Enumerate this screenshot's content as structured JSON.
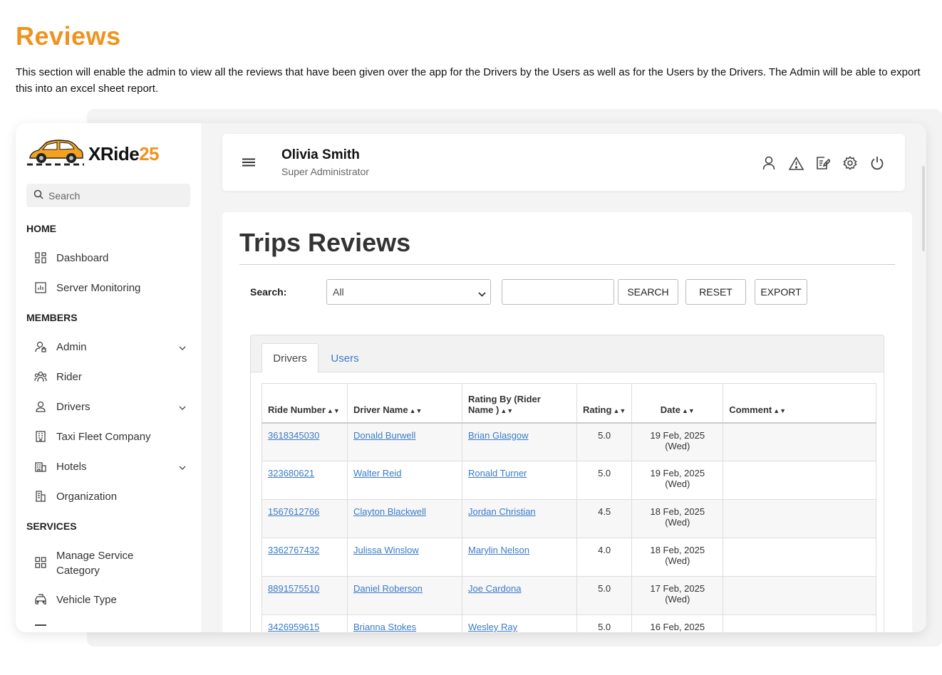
{
  "page": {
    "heading": "Reviews",
    "description": "This section will enable the admin to view all the reviews that have been given over the app for the Drivers by the Users as well as for the Users by the Drivers. The Admin will be able to export this into an excel sheet report."
  },
  "brand": {
    "name": "XRide",
    "suffix": "25",
    "accent": "#f0921e"
  },
  "sidebar": {
    "search_placeholder": "Search",
    "sections": {
      "home": "HOME",
      "members": "MEMBERS",
      "services": "SERVICES"
    },
    "items": {
      "dashboard": "Dashboard",
      "server_monitoring": "Server Monitoring",
      "admin": "Admin",
      "rider": "Rider",
      "drivers": "Drivers",
      "taxi_fleet": "Taxi Fleet Company",
      "hotels": "Hotels",
      "organization": "Organization",
      "manage_service_1": "Manage Service",
      "manage_service_2": "Category",
      "vehicle_type": "Vehicle Type"
    }
  },
  "header": {
    "user_name": "Olivia Smith",
    "user_role": "Super Administrator"
  },
  "main": {
    "title": "Trips Reviews",
    "search_label": "Search:",
    "filter_selected": "All",
    "search_button": "SEARCH",
    "reset_button": "RESET",
    "export_button": "EXPORT",
    "tabs": {
      "drivers": "Drivers",
      "users": "Users"
    },
    "columns": {
      "ride_number": "Ride Number",
      "driver_name": "Driver Name",
      "rating_by_1": "Rating By (Rider",
      "rating_by_2": "Name )",
      "rating": "Rating",
      "date": "Date",
      "comment": "Comment"
    },
    "rows": [
      {
        "ride": "3618345030",
        "driver": "Donald Burwell",
        "rider": "Brian Glasgow",
        "rating": "5.0",
        "date": "19 Feb, 2025",
        "day": "(Wed)",
        "comment": ""
      },
      {
        "ride": "323680621",
        "driver": "Walter Reid",
        "rider": "Ronald Turner",
        "rating": "5.0",
        "date": "19 Feb, 2025",
        "day": "(Wed)",
        "comment": ""
      },
      {
        "ride": "1567612766",
        "driver": "Clayton Blackwell",
        "rider": "Jordan Christian",
        "rating": "4.5",
        "date": "18 Feb, 2025",
        "day": "(Wed)",
        "comment": ""
      },
      {
        "ride": "3362767432",
        "driver": "Julissa Winslow",
        "rider": "Marylin Nelson",
        "rating": "4.0",
        "date": "18 Feb, 2025",
        "day": "(Wed)",
        "comment": ""
      },
      {
        "ride": "8891575510",
        "driver": "Daniel Roberson",
        "rider": "Joe Cardona",
        "rating": "5.0",
        "date": "17 Feb, 2025",
        "day": "(Wed)",
        "comment": ""
      },
      {
        "ride": "3426959615",
        "driver": "Brianna Stokes",
        "rider": "Wesley Ray",
        "rating": "5.0",
        "date": "16 Feb, 2025",
        "day": "",
        "comment": ""
      }
    ]
  }
}
